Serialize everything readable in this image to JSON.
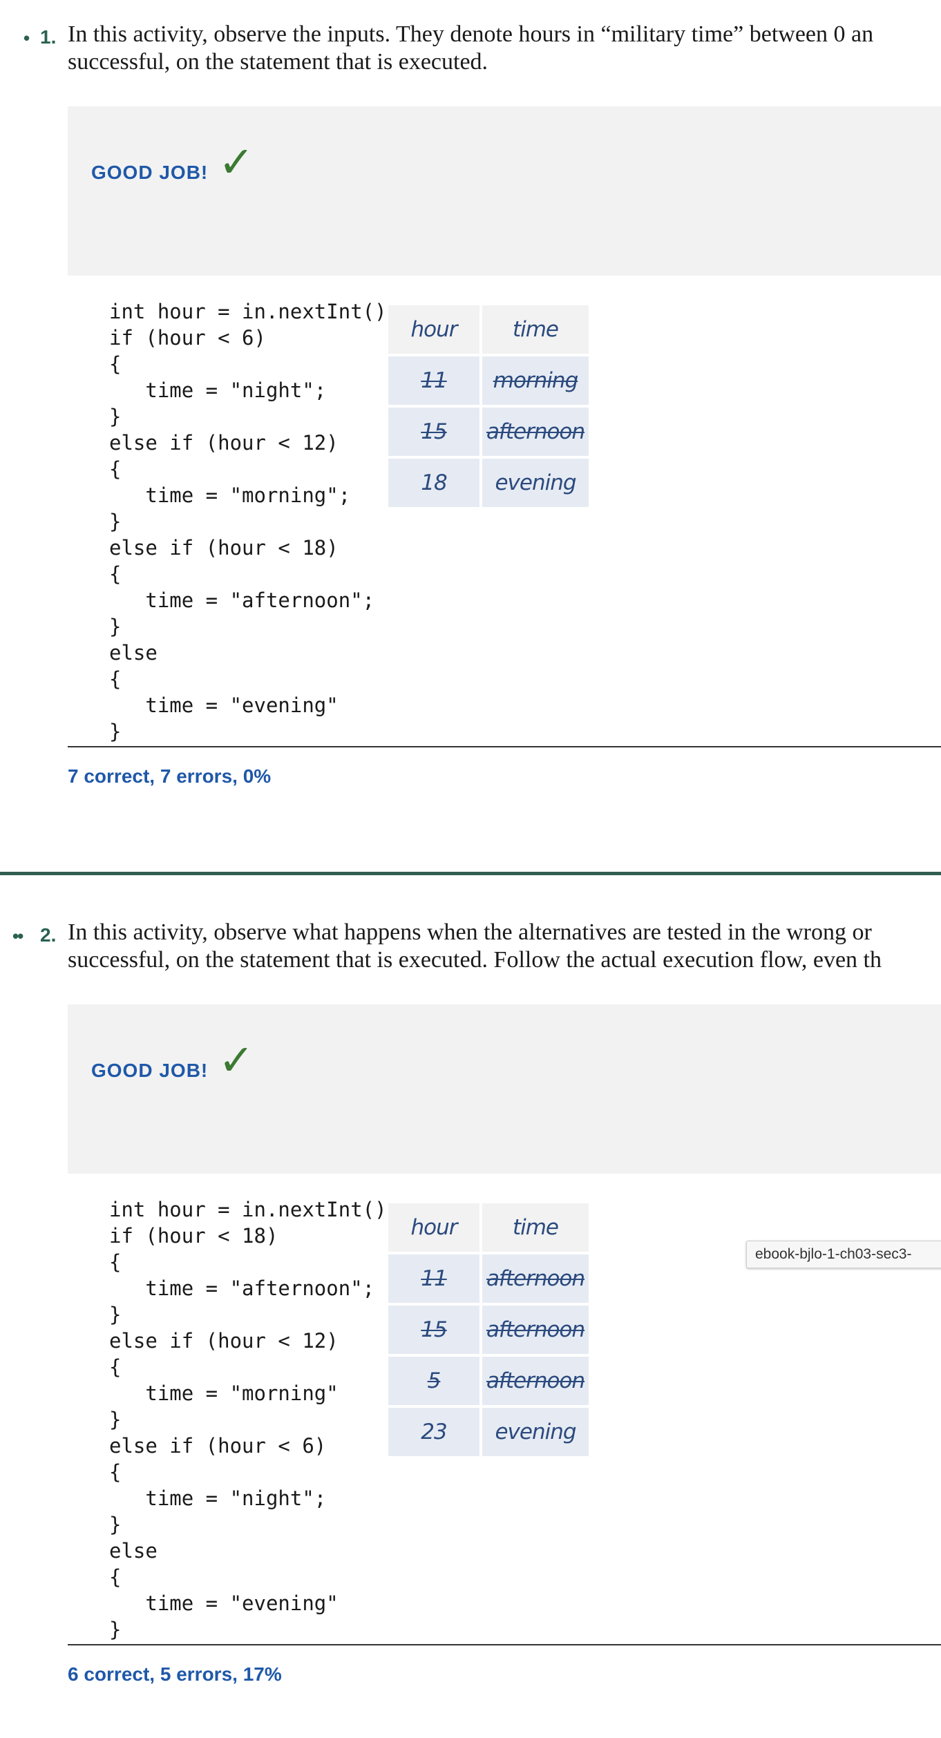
{
  "activities": [
    {
      "bullet": "•",
      "number": "1.",
      "question_lines": [
        "In this activity, observe the inputs. They denote hours in “military time” between 0 an",
        "successful, on the statement that is executed."
      ],
      "feedback": "GOOD JOB!",
      "check": "✓",
      "code_lines": [
        "int hour = in.nextInt();",
        "if (hour < 6)",
        "{",
        "   time = \"night\";",
        "}",
        "else if (hour < 12)",
        "{",
        "   time = \"morning\";",
        "}",
        "else if (hour < 18)",
        "{",
        "   time = \"afternoon\";",
        "}",
        "else",
        "{",
        "   time = \"evening\"",
        "}"
      ],
      "table": {
        "headers": [
          "hour",
          "time"
        ],
        "rows": [
          {
            "hour": "11",
            "time": "morning",
            "crossed": true
          },
          {
            "hour": "15",
            "time": "afternoon",
            "crossed": true
          },
          {
            "hour": "18",
            "time": "evening",
            "crossed": false
          }
        ]
      },
      "score": "7 correct, 7 errors, 0%"
    },
    {
      "bullet": "••",
      "number": "2.",
      "question_lines": [
        "In this activity, observe what happens when the alternatives are tested in the wrong or",
        "successful, on the statement that is executed. Follow the actual execution flow, even th"
      ],
      "feedback": "GOOD JOB!",
      "check": "✓",
      "code_lines": [
        "int hour = in.nextInt();",
        "if (hour < 18)",
        "{",
        "   time = \"afternoon\";",
        "}",
        "else if (hour < 12)",
        "{",
        "   time = \"morning\"",
        "}",
        "else if (hour < 6)",
        "{",
        "   time = \"night\";",
        "}",
        "else",
        "{",
        "   time = \"evening\"",
        "}"
      ],
      "table": {
        "headers": [
          "hour",
          "time"
        ],
        "rows": [
          {
            "hour": "11",
            "time": "afternoon",
            "crossed": true
          },
          {
            "hour": "15",
            "time": "afternoon",
            "crossed": true
          },
          {
            "hour": "5",
            "time": "afternoon",
            "crossed": true
          },
          {
            "hour": "23",
            "time": "evening",
            "crossed": false
          }
        ]
      },
      "score": "6 correct, 5 errors, 17%"
    }
  ],
  "tooltip": "ebook-bjlo-1-ch03-sec3-"
}
